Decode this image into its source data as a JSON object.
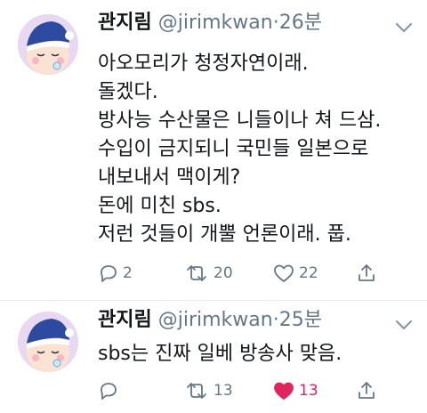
{
  "tweets": [
    {
      "name": "관지림",
      "handle": "@jirimkwan",
      "separator": "·",
      "time": "26분",
      "lines": [
        "아오모리가 청정자연이래.",
        "돌겠다.",
        "방사능 수산물은 니들이나 쳐 드삼.",
        "수입이 금지되니 국민들 일본으로",
        "내보내서 맥이게?",
        "돈에 미친 sbs.",
        "저런 것들이 개뿔 언론이래. 풉."
      ],
      "replies": "2",
      "retweets": "20",
      "likes": "22",
      "liked": false
    },
    {
      "name": "관지림",
      "handle": "@jirimkwan",
      "separator": "·",
      "time": "25분",
      "lines": [
        "sbs는 진짜 일베 방송사 맞음."
      ],
      "replies": "",
      "retweets": "13",
      "likes": "13",
      "liked": true
    }
  ],
  "icons": {
    "reply": "reply-icon",
    "retweet": "retweet-icon",
    "like": "heart-icon",
    "share": "share-icon",
    "menu": "chevron-down-icon"
  },
  "colors": {
    "muted": "#657786",
    "liked": "#e0245e",
    "avatar_bg": "#e8d8f1",
    "hat": "#2b4aa0"
  }
}
